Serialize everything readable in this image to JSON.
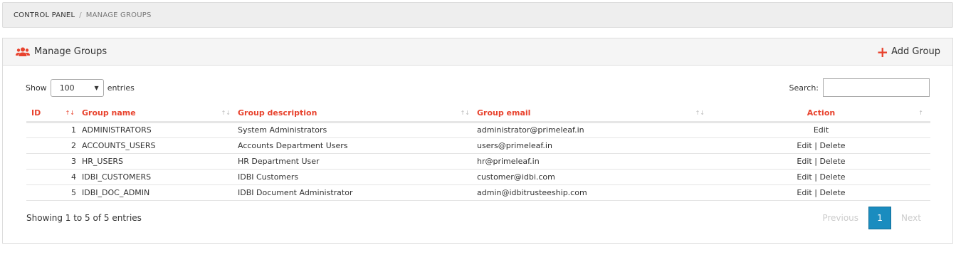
{
  "breadcrumb": {
    "home": "CONTROL PANEL",
    "separator": "/",
    "current": "MANAGE GROUPS"
  },
  "panel": {
    "title": "Manage Groups",
    "title_icon": "users-icon",
    "add_label": "Add Group",
    "accent": "#e8432e"
  },
  "controls": {
    "show_label": "Show",
    "entries_value": "100",
    "entries_label": "entries",
    "search_label": "Search:",
    "search_value": ""
  },
  "table": {
    "headers": {
      "id": "ID",
      "name": "Group name",
      "desc": "Group description",
      "email": "Group email",
      "action": "Action"
    },
    "rows": [
      {
        "id": "1",
        "name": "ADMINISTRATORS",
        "desc": "System Administrators",
        "email": "administrator@primeleaf.in",
        "edit": "Edit",
        "sep": "",
        "delete": ""
      },
      {
        "id": "2",
        "name": "ACCOUNTS_USERS",
        "desc": "Accounts Department Users",
        "email": "users@primeleaf.in",
        "edit": "Edit",
        "sep": "|",
        "delete": "Delete"
      },
      {
        "id": "3",
        "name": "HR_USERS",
        "desc": "HR Department User",
        "email": "hr@primeleaf.in",
        "edit": "Edit",
        "sep": "|",
        "delete": "Delete"
      },
      {
        "id": "4",
        "name": "IDBI_CUSTOMERS",
        "desc": "IDBI Customers",
        "email": "customer@idbi.com",
        "edit": "Edit",
        "sep": "|",
        "delete": "Delete"
      },
      {
        "id": "5",
        "name": "IDBI_DOC_ADMIN",
        "desc": "IDBI Document Administrator",
        "email": "admin@idbitrusteeship.com",
        "edit": "Edit",
        "sep": "|",
        "delete": "Delete"
      }
    ]
  },
  "footer": {
    "info": "Showing 1 to 5 of 5 entries",
    "previous": "Previous",
    "page": "1",
    "next": "Next",
    "page_color": "#1a8cbf"
  }
}
